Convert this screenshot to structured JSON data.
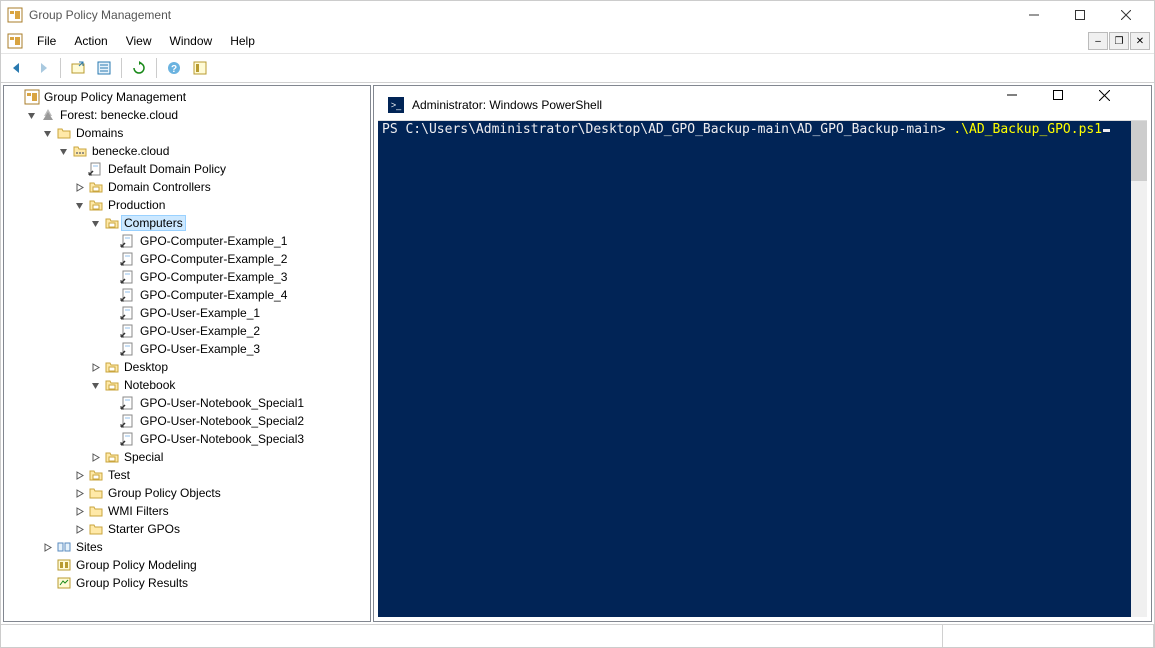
{
  "app": {
    "title": "Group Policy Management"
  },
  "menus": [
    "File",
    "Action",
    "View",
    "Window",
    "Help"
  ],
  "tree": {
    "root": "Group Policy Management",
    "forest": "Forest: benecke.cloud",
    "domains": "Domains",
    "domain": "benecke.cloud",
    "ddp": "Default Domain Policy",
    "dc": "Domain Controllers",
    "prod": "Production",
    "computers": "Computers",
    "gpo_c1": "GPO-Computer-Example_1",
    "gpo_c2": "GPO-Computer-Example_2",
    "gpo_c3": "GPO-Computer-Example_3",
    "gpo_c4": "GPO-Computer-Example_4",
    "gpo_u1": "GPO-User-Example_1",
    "gpo_u2": "GPO-User-Example_2",
    "gpo_u3": "GPO-User-Example_3",
    "desktop": "Desktop",
    "notebook": "Notebook",
    "nb1": "GPO-User-Notebook_Special1",
    "nb2": "GPO-User-Notebook_Special2",
    "nb3": "GPO-User-Notebook_Special3",
    "special": "Special",
    "test": "Test",
    "gpoobjs": "Group Policy Objects",
    "wmi": "WMI Filters",
    "starter": "Starter GPOs",
    "sites": "Sites",
    "modeling": "Group Policy Modeling",
    "results": "Group Policy Results"
  },
  "ps": {
    "title": "Administrator: Windows PowerShell",
    "prompt": "PS C:\\Users\\Administrator\\Desktop\\AD_GPO_Backup-main\\AD_GPO_Backup-main> ",
    "cmd": ".\\AD_Backup_GPO.ps1"
  }
}
